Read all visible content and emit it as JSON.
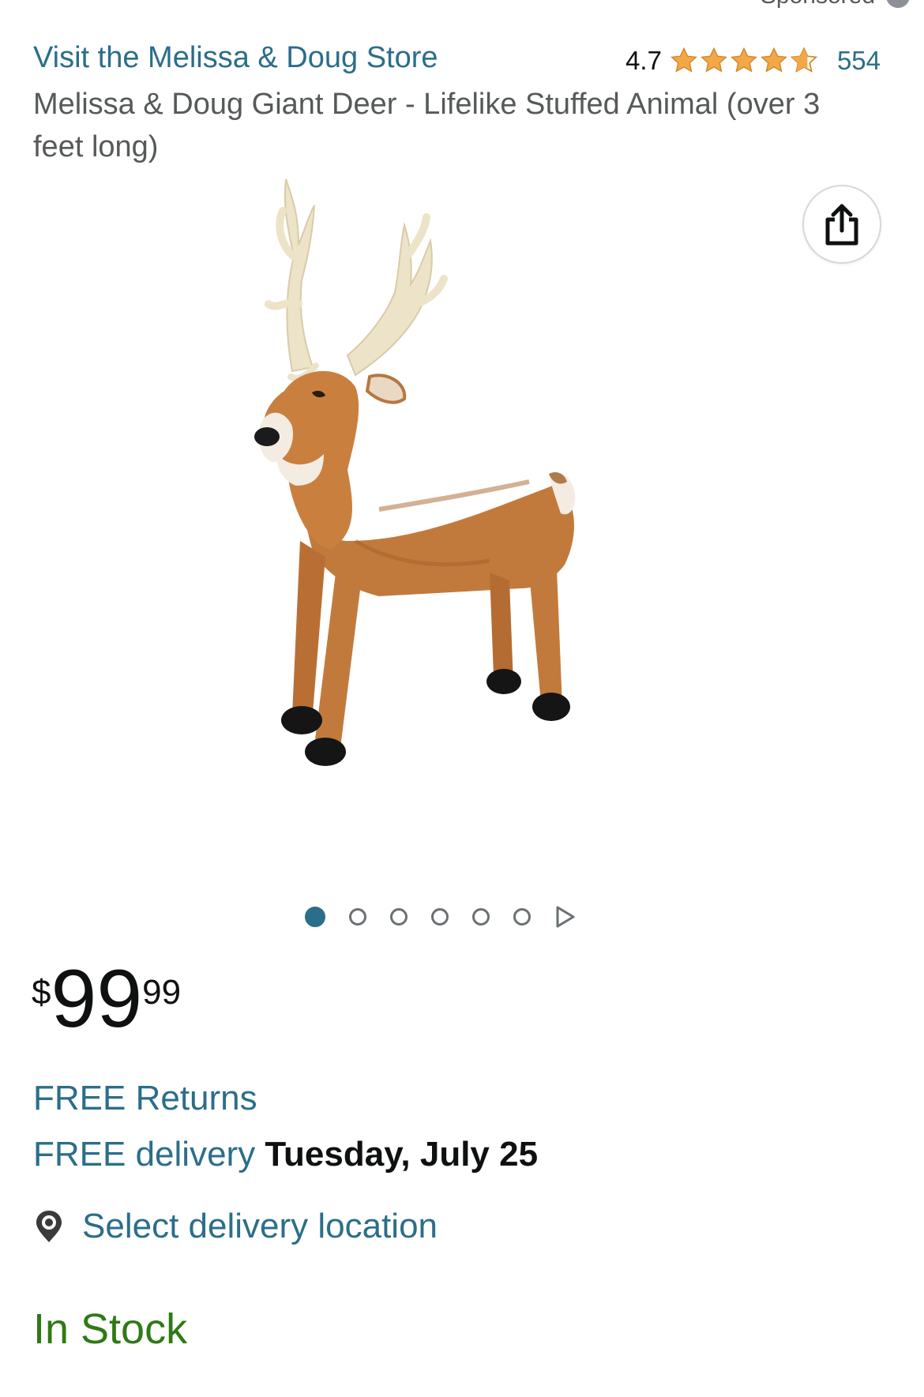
{
  "header": {
    "sponsored_label": "Sponsored"
  },
  "product": {
    "store_link": "Visit the Melissa & Doug Store",
    "rating_value": "4.7",
    "rating_stars": 4.7,
    "rating_count": "554",
    "title": "Melissa & Doug Giant Deer - Lifelike Stuffed Animal (over 3 feet long)",
    "image_icon": "deer-product-image",
    "share_icon": "share-icon"
  },
  "gallery": {
    "image_count": 6,
    "active_index": 0,
    "next_icon": "play-triangle-icon"
  },
  "price": {
    "symbol": "$",
    "whole": "99",
    "fraction": "99"
  },
  "shipping": {
    "returns": "FREE Returns",
    "delivery_prefix": "FREE delivery",
    "delivery_date": "Tuesday, July 25",
    "location_label": "Select delivery location",
    "location_icon": "location-pin-icon"
  },
  "availability": {
    "status": "In Stock"
  },
  "colors": {
    "link": "#2b6e8a",
    "star": "#f3a847",
    "in_stock": "#2f7a14"
  }
}
